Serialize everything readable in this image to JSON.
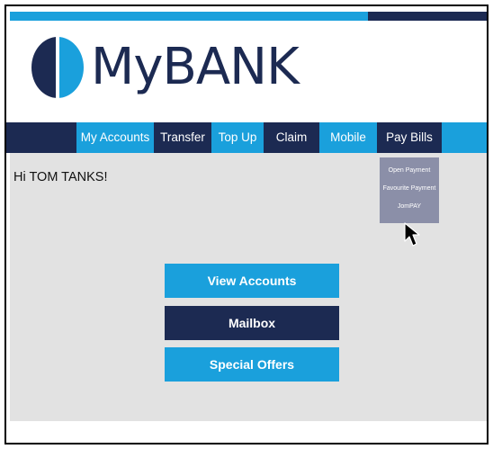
{
  "brand": {
    "logo_text": "MyBANK",
    "colors": {
      "light_blue": "#1aa0dc",
      "navy": "#1c2a52",
      "content_bg": "#e2e2e2"
    }
  },
  "nav": {
    "items": [
      {
        "label": "My Accounts"
      },
      {
        "label": "Transfer"
      },
      {
        "label": "Top Up"
      },
      {
        "label": "Claim"
      },
      {
        "label": "Mobile"
      },
      {
        "label": "Pay Bills"
      }
    ]
  },
  "greeting": "Hi TOM TANKS!",
  "pay_bills_menu": {
    "items": [
      {
        "label": "Open Payment"
      },
      {
        "label": "Favourite Payment"
      },
      {
        "label": "JomPAY"
      }
    ]
  },
  "buttons": {
    "view_accounts": "View Accounts",
    "mailbox": "Mailbox",
    "special_offers": "Special Offers"
  },
  "icons": {
    "logo": "half-circle-logo-icon",
    "cursor": "mouse-pointer-icon"
  }
}
